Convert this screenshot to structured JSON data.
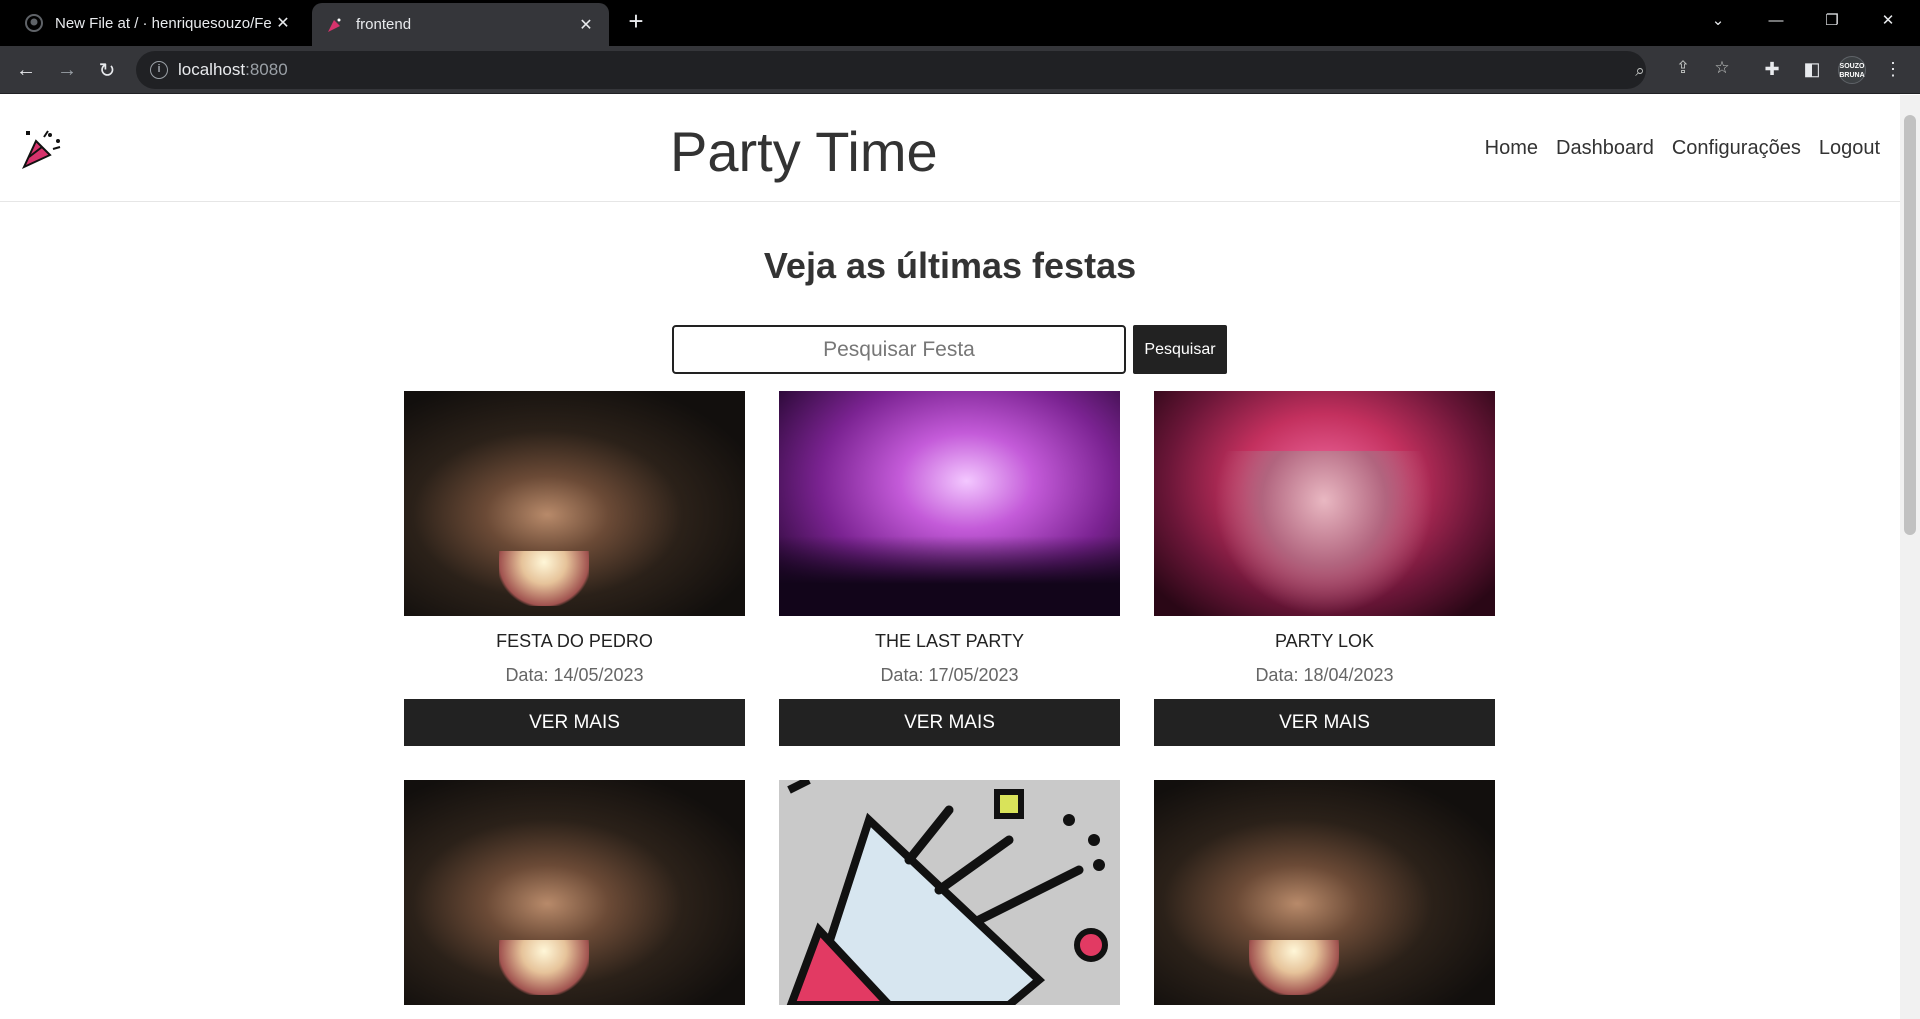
{
  "browser": {
    "tabs": [
      {
        "title": "New File at / · henriquesouzo/Fe",
        "active": false,
        "icon": "github-icon"
      },
      {
        "title": "frontend",
        "active": true,
        "icon": "party-popper-icon"
      }
    ],
    "url_host": "localhost",
    "url_port": ":8080",
    "profile_label": "SOUZO\nBRUNA"
  },
  "site": {
    "title": "Party Time",
    "nav": [
      "Home",
      "Dashboard",
      "Configurações",
      "Logout"
    ]
  },
  "main": {
    "heading": "Veja as últimas festas",
    "search_placeholder": "Pesquisar Festa",
    "search_button": "Pesquisar",
    "parties": [
      {
        "name": "FESTA DO PEDRO",
        "date": "Data: 14/05/2023",
        "button": "VER MAIS",
        "image": "cake"
      },
      {
        "name": "THE LAST PARTY",
        "date": "Data: 17/05/2023",
        "button": "VER MAIS",
        "image": "fire"
      },
      {
        "name": "PARTY LOK",
        "date": "Data: 18/04/2023",
        "button": "VER MAIS",
        "image": "mask"
      },
      {
        "name": "",
        "date": "",
        "button": "",
        "image": "cake"
      },
      {
        "name": "",
        "date": "",
        "button": "",
        "image": "popper"
      },
      {
        "name": "",
        "date": "",
        "button": "",
        "image": "cake"
      }
    ]
  }
}
